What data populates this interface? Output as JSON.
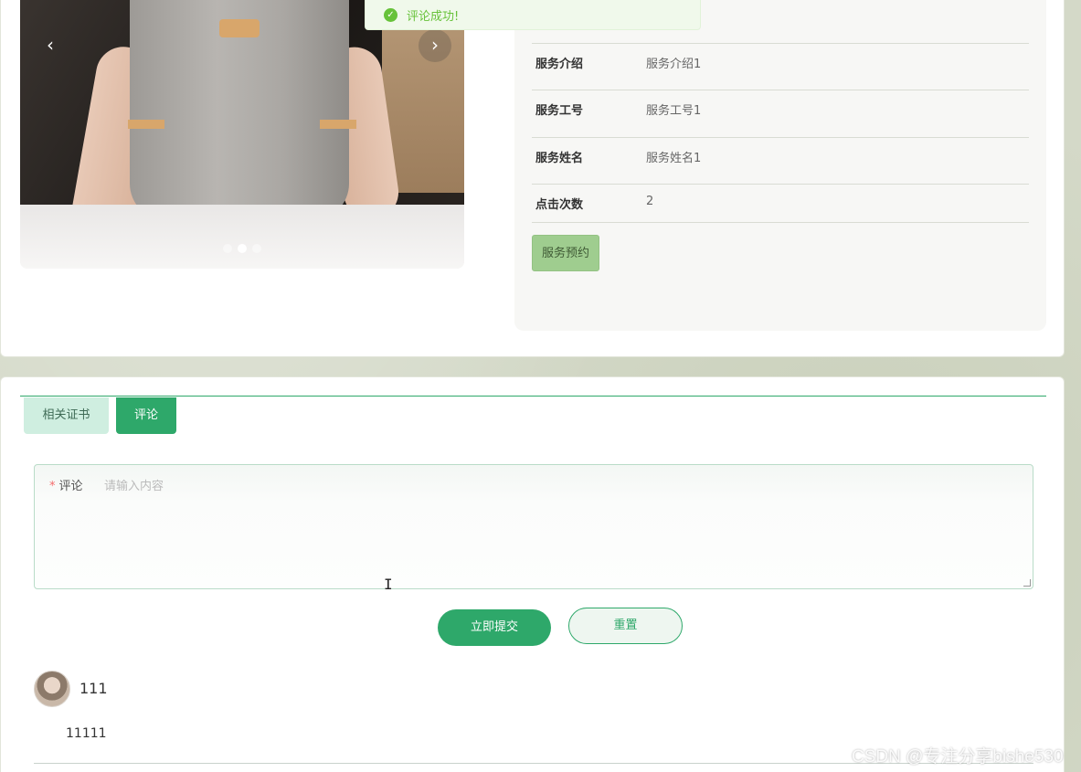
{
  "toast": {
    "message": "评论成功!"
  },
  "carousel": {
    "prev": "‹",
    "next": "›"
  },
  "service_info": {
    "rows": [
      {
        "label": "服务介绍",
        "value": "服务介绍1"
      },
      {
        "label": "服务工号",
        "value": "服务工号1"
      },
      {
        "label": "服务姓名",
        "value": "服务姓名1"
      },
      {
        "label": "点击次数",
        "value": "2"
      }
    ],
    "book_button": "服务预约"
  },
  "tabs": [
    {
      "label": "相关证书",
      "active": false
    },
    {
      "label": "评论",
      "active": true
    }
  ],
  "comment_form": {
    "label": "评论",
    "required_mark": "*",
    "placeholder": "请输入内容",
    "submit": "立即提交",
    "reset": "重置"
  },
  "comments": [
    {
      "username": "111",
      "text": "11111"
    }
  ],
  "watermark": "CSDN @专注分享bishe530",
  "colors": {
    "primary": "#2ea86a",
    "success": "#67c23a",
    "book_button": "#9fcd8f"
  }
}
